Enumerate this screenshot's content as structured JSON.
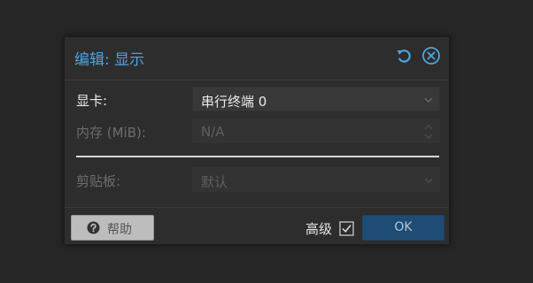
{
  "dialog": {
    "title": "编辑: 显示",
    "icons": {
      "reset": "reset-icon",
      "close": "close-icon"
    }
  },
  "form": {
    "display": {
      "label": "显卡:",
      "value": "串行终端 0",
      "enabled": true
    },
    "memory": {
      "label": "内存 (MiB):",
      "placeholder": "N/A",
      "enabled": false
    },
    "clipboard": {
      "label": "剪贴板:",
      "value": "默认",
      "enabled": false
    }
  },
  "footer": {
    "help_label": "帮助",
    "advanced_label": "高级",
    "advanced_checked": true,
    "ok_label": "OK"
  },
  "colors": {
    "accent": "#4fa3de",
    "ok_button": "#1e4c74",
    "help_button": "#bdbdbd",
    "dialog_bg": "#2d2d2d"
  }
}
